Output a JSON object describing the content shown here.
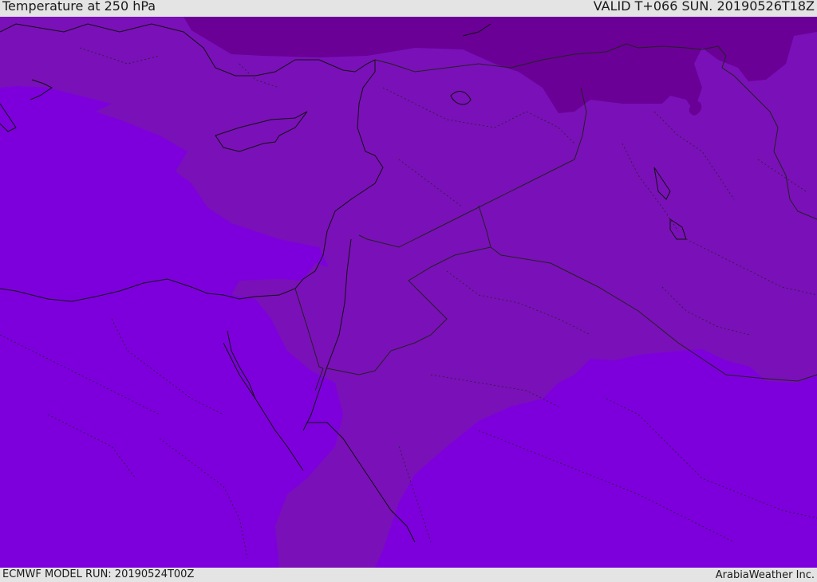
{
  "header": {
    "title": "Temperature at 250 hPa",
    "valid_time": "VALID T+066 SUN. 20190526T18Z"
  },
  "footer": {
    "model_run": "ECMWF MODEL RUN: 20190524T00Z",
    "credit": "ArabiaWeather Inc."
  },
  "map": {
    "colors": {
      "warm": "#7d00dc",
      "mid": "#7a10b8",
      "cold": "#6a0096",
      "coast": "#111111",
      "border": "#222222"
    }
  }
}
